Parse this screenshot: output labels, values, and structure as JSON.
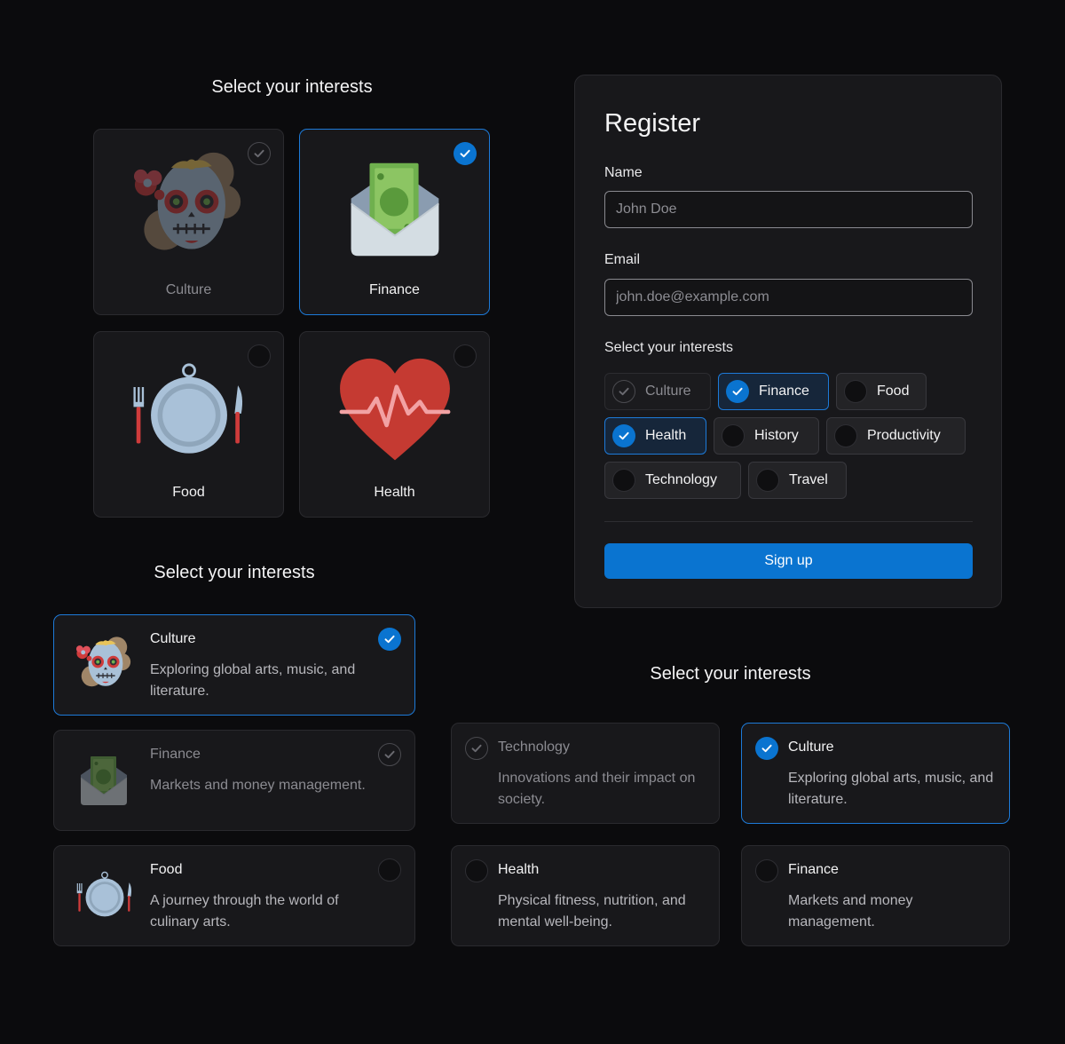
{
  "section1": {
    "heading": "Select your interests",
    "tiles": [
      {
        "label": "Culture",
        "state": "disabled",
        "icon": "sugar-skull-icon"
      },
      {
        "label": "Finance",
        "state": "selected",
        "icon": "money-envelope-icon"
      },
      {
        "label": "Food",
        "state": "unselected",
        "icon": "plate-cutlery-icon"
      },
      {
        "label": "Health",
        "state": "unselected",
        "icon": "heartbeat-icon"
      }
    ]
  },
  "register": {
    "title": "Register",
    "name_label": "Name",
    "name_placeholder": "John Doe",
    "email_label": "Email",
    "email_placeholder": "john.doe@example.com",
    "interests_label": "Select your interests",
    "chips": [
      {
        "label": "Culture",
        "state": "disabled"
      },
      {
        "label": "Finance",
        "state": "selected"
      },
      {
        "label": "Food",
        "state": "unselected"
      },
      {
        "label": "Health",
        "state": "selected"
      },
      {
        "label": "History",
        "state": "unselected"
      },
      {
        "label": "Productivity",
        "state": "unselected"
      },
      {
        "label": "Technology",
        "state": "unselected"
      },
      {
        "label": "Travel",
        "state": "unselected"
      }
    ],
    "submit_label": "Sign up"
  },
  "section2": {
    "heading": "Select your interests",
    "cards": [
      {
        "title": "Culture",
        "description": "Exploring global arts, music, and literature.",
        "state": "selected",
        "icon": "sugar-skull-icon"
      },
      {
        "title": "Finance",
        "description": "Markets and money management.",
        "state": "disabled",
        "icon": "money-envelope-icon"
      },
      {
        "title": "Food",
        "description": "A journey through the world of culinary arts.",
        "state": "unselected",
        "icon": "plate-cutlery-icon"
      }
    ]
  },
  "section3": {
    "heading": "Select your interests",
    "cards": [
      {
        "title": "Technology",
        "description": "Innovations and their impact on society.",
        "state": "disabled"
      },
      {
        "title": "Culture",
        "description": "Exploring global arts, music, and literature.",
        "state": "selected"
      },
      {
        "title": "Health",
        "description": "Physical fitness, nutrition, and mental well-being.",
        "state": "unselected"
      },
      {
        "title": "Finance",
        "description": "Markets and money management.",
        "state": "unselected"
      }
    ]
  },
  "colors": {
    "background": "#0b0b0d",
    "surface": "#18181b",
    "accent": "#0a74d0",
    "selected_border": "#1d7ad8"
  }
}
